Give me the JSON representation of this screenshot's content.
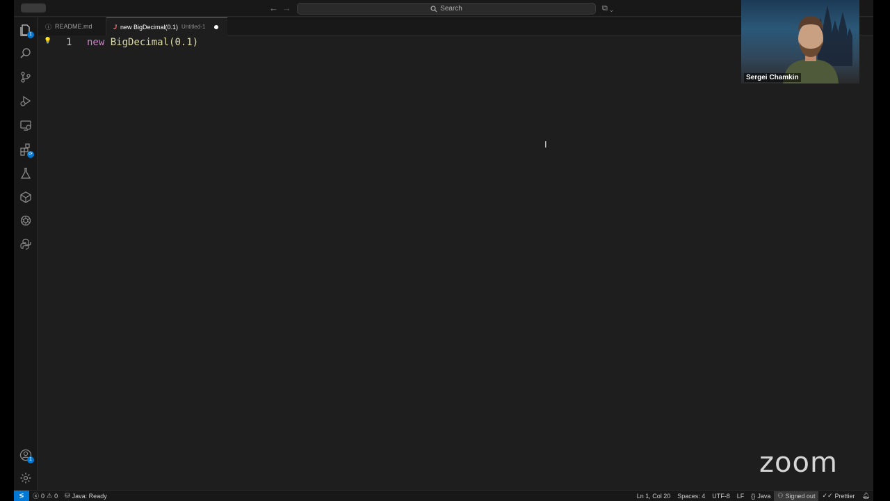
{
  "titlebar": {
    "search_label": "Search",
    "nav_back": "←",
    "nav_forward": "→",
    "layout_icon": "⧉ ⌄"
  },
  "activity_bar": {
    "items": [
      {
        "icon": "explorer-icon",
        "badge": "1"
      },
      {
        "icon": "search-icon"
      },
      {
        "icon": "source-control-icon"
      },
      {
        "icon": "run-debug-icon"
      },
      {
        "icon": "remote-explorer-icon"
      },
      {
        "icon": "extensions-icon",
        "badge": "⟳"
      },
      {
        "icon": "testing-icon"
      },
      {
        "icon": "containers-icon"
      },
      {
        "icon": "openai-icon"
      },
      {
        "icon": "python-icon"
      }
    ],
    "account_badge": "1",
    "accounts_icon": "account-icon",
    "settings_icon": "gear-icon"
  },
  "tabs": [
    {
      "label": "README.md",
      "icon": "ⓘ",
      "active": false
    },
    {
      "label": "new BigDecimal(0.1)",
      "sublabel": "Untitled-1",
      "icon": "J",
      "active": true,
      "dirty": true
    }
  ],
  "editor": {
    "line_number": "1",
    "code_keyword": "new",
    "code_rest": "BigDecimal(0.1)"
  },
  "statusbar": {
    "remote": "≶",
    "errors": "0",
    "warnings": "0",
    "java_status": "Java: Ready",
    "position": "Ln 1, Col 20",
    "spaces": "Spaces: 4",
    "encoding": "UTF-8",
    "eol": "LF",
    "language": "Java",
    "signed_out": "Signed out",
    "prettier": "Prettier"
  },
  "zoom": {
    "participant_name": "Sergei Chamkin",
    "logo": "zoom"
  },
  "colors": {
    "accent": "#0078d4",
    "keyword": "#c586c0",
    "function": "#dcdcaa"
  }
}
